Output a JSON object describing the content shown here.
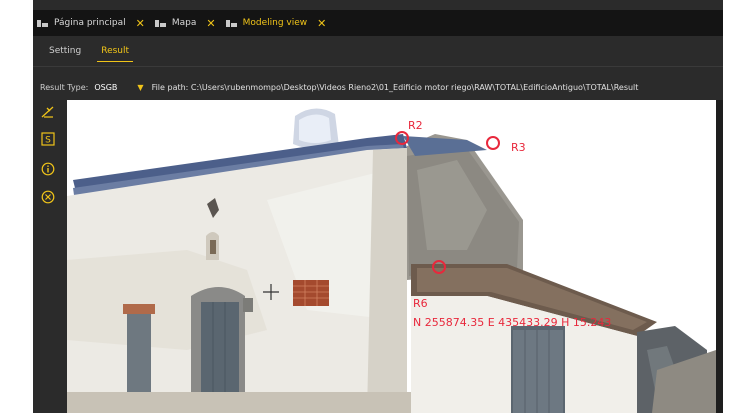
{
  "tabs": [
    {
      "label": "Página principal",
      "close": "✕",
      "icon": "tab-icon"
    },
    {
      "label": "Mapa",
      "close": "✕",
      "icon": "tab-icon"
    },
    {
      "label": "Modeling view",
      "close": "✕",
      "icon": "tab-icon",
      "active": true
    }
  ],
  "subtabs": {
    "setting": "Setting",
    "result": "Result"
  },
  "resultbar": {
    "type_label": "Result Type:",
    "type_value": "OSGB",
    "filepath": "File path: C:\\Users\\rubenmompo\\Desktop\\Videos Rieno2\\01_Edificio motor riego\\RAW\\TOTAL\\EdificioAntiguo\\TOTAL\\Result"
  },
  "tools": [
    {
      "name": "measure-icon"
    },
    {
      "name": "s-box-icon"
    },
    {
      "name": "info-icon"
    },
    {
      "name": "cancel-icon"
    }
  ],
  "markers": {
    "r2": "R2",
    "r3": "R3",
    "r6": "R6",
    "coords": "N 255874.35 E 435433.29 H 15.243"
  },
  "colors": {
    "accent": "#f0c419",
    "marker": "#e8283c",
    "tabbar": "#141414",
    "panel": "#2b2b2b"
  }
}
